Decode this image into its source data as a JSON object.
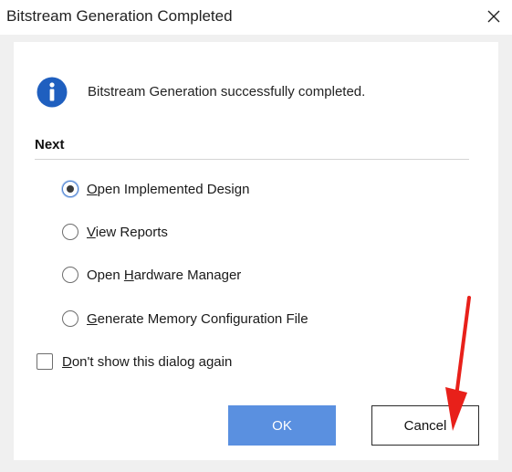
{
  "window": {
    "title": "Bitstream Generation Completed",
    "close_glyph": "✕"
  },
  "message": {
    "icon": "info-icon",
    "text": "Bitstream Generation successfully completed."
  },
  "next": {
    "heading": "Next",
    "options": [
      {
        "pre": "",
        "mnemonic": "O",
        "post": "pen Implemented Design",
        "selected": true
      },
      {
        "pre": "",
        "mnemonic": "V",
        "post": "iew Reports",
        "selected": false
      },
      {
        "pre": "Open ",
        "mnemonic": "H",
        "post": "ardware Manager",
        "selected": false
      },
      {
        "pre": "",
        "mnemonic": "G",
        "post": "enerate Memory Configuration File",
        "selected": false
      }
    ]
  },
  "dont_show": {
    "pre": "",
    "mnemonic": "D",
    "post": "on't show this dialog again",
    "checked": false
  },
  "buttons": {
    "ok": "OK",
    "cancel": "Cancel"
  },
  "colors": {
    "ok_button": "#5a90e0",
    "info_icon": "#1f5fbf",
    "annotation_arrow": "#e8201a"
  }
}
